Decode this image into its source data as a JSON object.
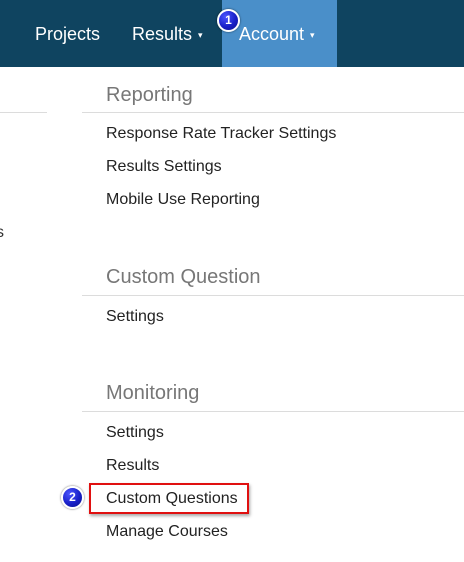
{
  "navbar": {
    "projects_label": "Projects",
    "results_label": "Results",
    "account_label": "Account",
    "caret": "▾"
  },
  "annotations": {
    "badge_1": "1",
    "badge_2": "2"
  },
  "left_panel": {
    "fragment": "s"
  },
  "menu": {
    "sections": [
      {
        "heading": "Reporting",
        "items": [
          "Response Rate Tracker Settings",
          "Results Settings",
          "Mobile Use Reporting"
        ]
      },
      {
        "heading": "Custom Question",
        "items": [
          "Settings"
        ]
      },
      {
        "heading": "Monitoring",
        "items": [
          "Settings",
          "Results",
          "Custom Questions",
          "Manage Courses"
        ]
      }
    ]
  },
  "colors": {
    "navbar_bg": "#0f4460",
    "account_active_bg": "#4a8fc9",
    "badge_blue": "#1820c8",
    "highlight_red": "#e01010"
  }
}
